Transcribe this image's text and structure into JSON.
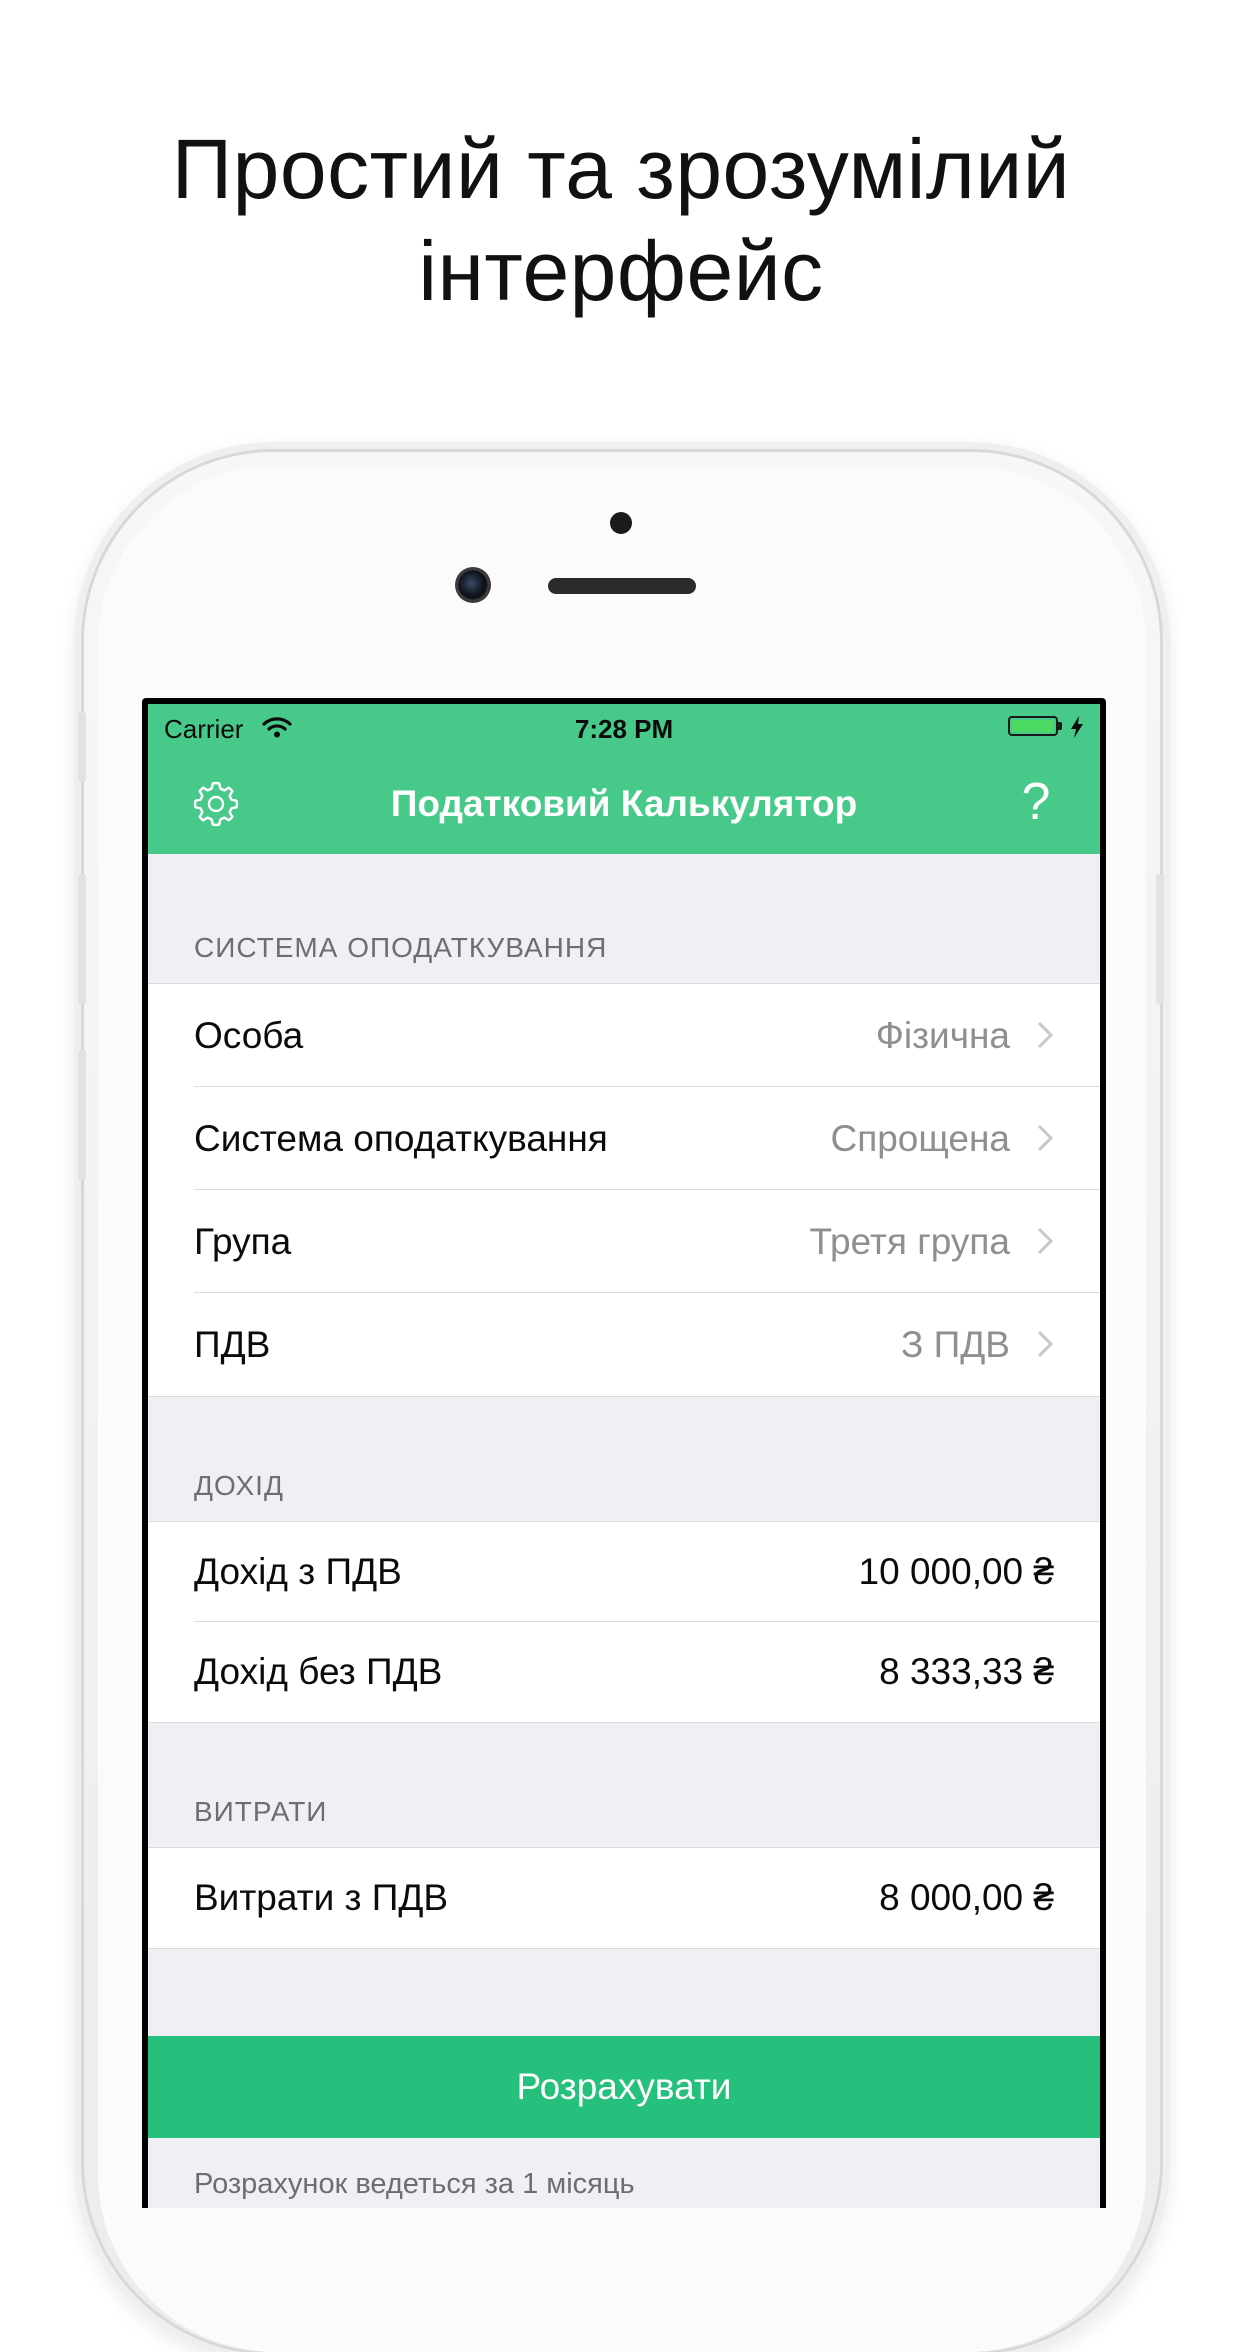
{
  "headline": {
    "line1": "Простий та зрозумілий",
    "line2": "інтерфейс"
  },
  "status_bar": {
    "carrier": "Carrier",
    "time": "7:28 PM",
    "battery_color": "#4cd964"
  },
  "nav": {
    "title": "Податковий Калькулятор",
    "settings_icon": "gear-icon",
    "help_label": "?",
    "background": "#47c98a"
  },
  "sections": {
    "taxation": {
      "header": "СИСТЕМА ОПОДАТКУВАННЯ",
      "rows": [
        {
          "label": "Особа",
          "value": "Фізична"
        },
        {
          "label": "Система оподаткування",
          "value": "Спрощена"
        },
        {
          "label": "Група",
          "value": "Третя група"
        },
        {
          "label": "ПДВ",
          "value": "З ПДВ"
        }
      ]
    },
    "income": {
      "header": "ДОХІД",
      "rows": [
        {
          "label": "Дохід з ПДВ",
          "value": "10 000,00 ₴"
        },
        {
          "label": "Дохід без ПДВ",
          "value": "8 333,33 ₴"
        }
      ]
    },
    "expenses": {
      "header": "ВИТРАТИ",
      "rows": [
        {
          "label": "Витрати з ПДВ",
          "value": "8 000,00 ₴"
        }
      ]
    }
  },
  "calculate_button": {
    "label": "Розрахувати",
    "color": "#25c07b"
  },
  "footnote": "Розрахунок ведеться за 1 місяць"
}
